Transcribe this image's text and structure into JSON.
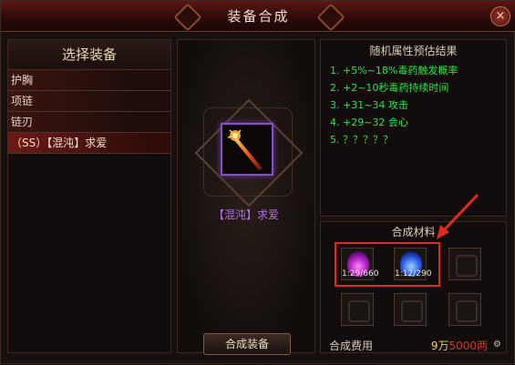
{
  "window": {
    "title": "装备合成",
    "close_glyph": "×"
  },
  "left": {
    "header": "选择装备",
    "items": [
      {
        "label": "护胸",
        "selected": false
      },
      {
        "label": "项链",
        "selected": false
      },
      {
        "label": "链刃",
        "selected": false
      },
      {
        "label": "（SS）【混沌】求爱",
        "selected": true
      }
    ]
  },
  "center": {
    "item_name": "【混沌】求爱",
    "item_icon": "flaming-staff-icon",
    "combine_button": "合成装备"
  },
  "attributes": {
    "title": "随机属性预估结果",
    "lines": [
      "1. +5%~18%毒药触发概率",
      "2. +2~10秒毒药持续时间",
      "3. +31~34 攻击",
      "4. +29~32 会心",
      "5. ？？？？？"
    ]
  },
  "materials": {
    "title": "合成材料",
    "slots": [
      {
        "type": "purple-orb-icon",
        "count": "1:29/660"
      },
      {
        "type": "blue-orb-icon",
        "count": "1:12/290"
      },
      {
        "type": "empty"
      },
      {
        "type": "empty"
      },
      {
        "type": "empty"
      },
      {
        "type": "empty"
      }
    ],
    "cost_label": "合成费用",
    "cost_wan": "9万",
    "cost_liang": "5000两",
    "highlight_color": "#e02a20"
  }
}
